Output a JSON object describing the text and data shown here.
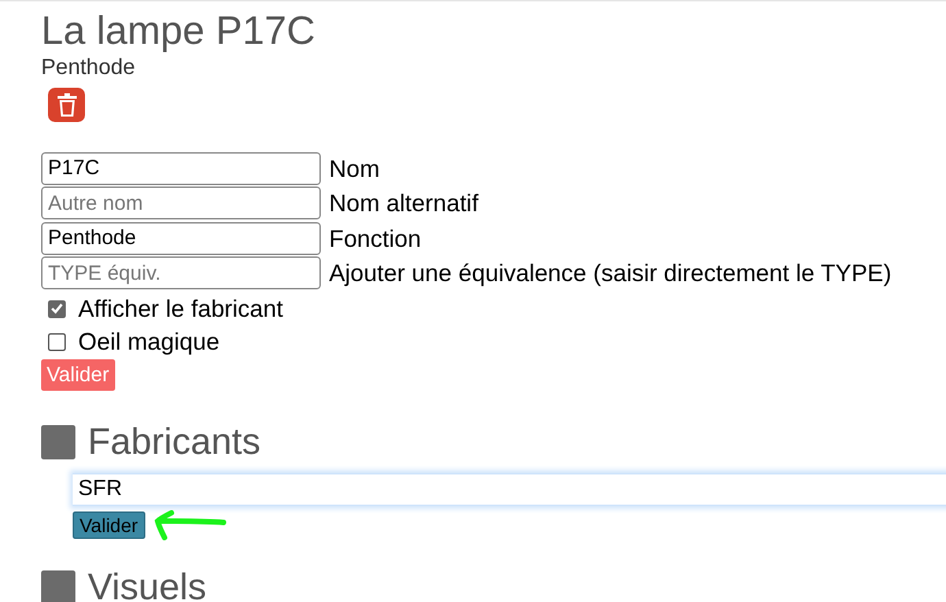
{
  "title": "La lampe P17C",
  "subtitle": "Penthode",
  "fields": [
    {
      "value": "P17C",
      "label": "Nom"
    },
    {
      "placeholder": "Autre nom",
      "label": "Nom alternatif"
    },
    {
      "value": "Penthode",
      "label": "Fonction"
    },
    {
      "placeholder": "TYPE équiv.",
      "label": "Ajouter une équivalence (saisir directement le TYPE)"
    }
  ],
  "checkboxes": [
    {
      "label": "Afficher le fabricant",
      "checked": true
    },
    {
      "label": "Oeil magique",
      "checked": false
    }
  ],
  "submit_button": "Valider",
  "sections": [
    {
      "title": "Fabricants",
      "input": {
        "value": "SFR"
      },
      "button": "Valider"
    },
    {
      "title": "Visuels"
    }
  ]
}
